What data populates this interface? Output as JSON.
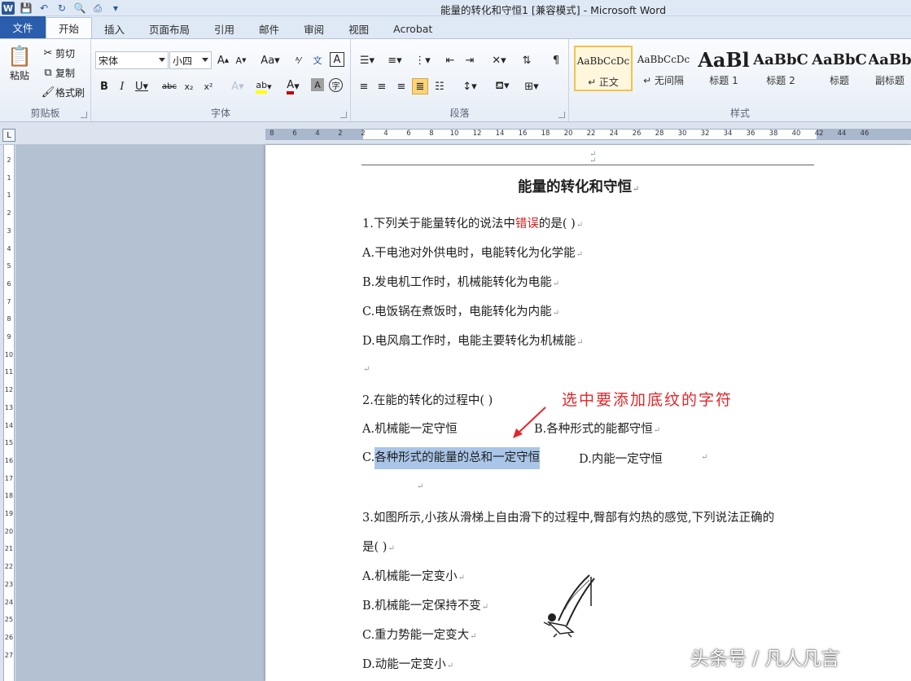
{
  "window": {
    "title": "能量的转化和守恒1 [兼容模式] - Microsoft Word"
  },
  "tabs": [
    "文件",
    "开始",
    "插入",
    "页面布局",
    "引用",
    "邮件",
    "审阅",
    "视图",
    "Acrobat"
  ],
  "ribbon": {
    "clipboard": {
      "paste": "粘贴",
      "cut": "剪切",
      "copy": "复制",
      "format_painter": "格式刷",
      "label": "剪贴板"
    },
    "font": {
      "font_name": "宋体",
      "font_size": "小四",
      "label": "字体"
    },
    "paragraph": {
      "label": "段落"
    },
    "styles": {
      "label": "样式",
      "items": [
        {
          "sample": "AaBbCcDc",
          "name": "↵ 正文"
        },
        {
          "sample": "AaBbCcDc",
          "name": "↵ 无间隔"
        },
        {
          "sample": "AaBl",
          "name": "标题 1"
        },
        {
          "sample": "AaBbC",
          "name": "标题 2"
        },
        {
          "sample": "AaBbC",
          "name": "标题"
        },
        {
          "sample": "AaBb",
          "name": "副标题"
        }
      ]
    }
  },
  "ruler": {
    "ticks": [
      "8",
      "6",
      "4",
      "2",
      "2",
      "4",
      "6",
      "8",
      "10",
      "12",
      "14",
      "16",
      "18",
      "20",
      "22",
      "24",
      "26",
      "28",
      "30",
      "32",
      "34",
      "36",
      "38",
      "40",
      "42",
      "44",
      "46"
    ]
  },
  "vruler": {
    "ticks": [
      "2",
      "1",
      "1",
      "2",
      "3",
      "4",
      "5",
      "6",
      "7",
      "8",
      "9",
      "10",
      "11",
      "12",
      "13",
      "14",
      "15",
      "16",
      "17",
      "18",
      "19",
      "20",
      "21",
      "22",
      "23",
      "24",
      "25",
      "26",
      "27"
    ]
  },
  "document": {
    "title": "能量的转化和守恒",
    "q1": {
      "stem_a": "1.下列关于能量转化的说法中",
      "stem_red": "错误",
      "stem_b": "的是(   )"
    },
    "q1_options": [
      "A.干电池对外供电时，电能转化为化学能",
      "B.发电机工作时，机械能转化为电能",
      "C.电饭锅在煮饭时，电能转化为内能",
      "D.电风扇工作时，电能主要转化为机械能"
    ],
    "q2": {
      "stem": "2.在能的转化的过程中(   )",
      "opt_a": "A.机械能一定守恒",
      "opt_b": "B.各种形式的能都守恒",
      "opt_c_prefix": "C.",
      "opt_c_selected": "各种形式的能量的总和一定守恒",
      "opt_d": "D.内能一定守恒"
    },
    "q3": {
      "stem_line1": "3.如图所示,小孩从滑梯上自由滑下的过程中,臀部有灼热的感觉,下列说法正确的",
      "stem_line2": "是(   )",
      "options": [
        "A.机械能一定变小",
        "B.机械能一定保持不变",
        "C.重力势能一定变大",
        "D.动能一定变小"
      ]
    }
  },
  "annotation": "选中要添加底纹的字符",
  "watermark": "头条号 / 凡人凡言"
}
